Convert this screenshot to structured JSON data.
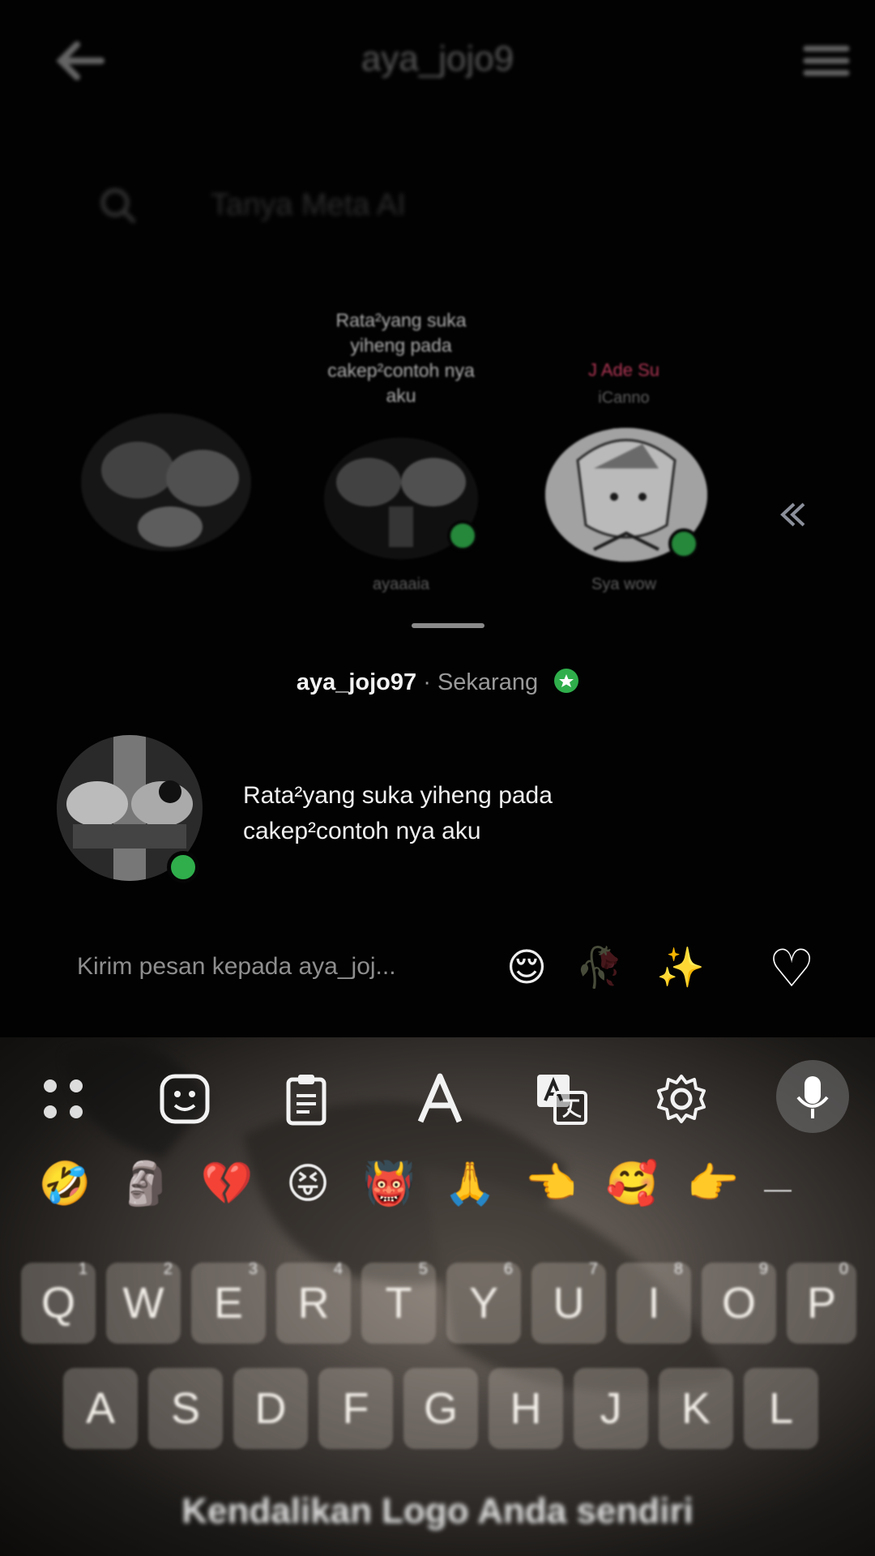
{
  "header": {
    "title": "aya_jojo9"
  },
  "search": {
    "placeholder": "Tanya Meta AI"
  },
  "notes": [
    {
      "bubble": "Rata²yang suka yiheng pada cakep²contoh nya aku",
      "name": "ayaaaia"
    },
    {
      "music": "J Ade Su",
      "music_artist": "iCanno",
      "name": "Sya wow"
    }
  ],
  "sheet": {
    "username": "aya_jojo97",
    "separator": "·",
    "time": "Sekarang",
    "message": "Rata²yang suka yiheng pada cakep²contoh nya aku"
  },
  "composer": {
    "placeholder": "Kirim pesan kepada aya_joj...",
    "quick_reactions": [
      "😌",
      "🥀",
      "✨",
      "♡"
    ]
  },
  "keyboard": {
    "emoji_suggestions": [
      "🤣",
      "🗿",
      "💔",
      "😝",
      "👹",
      "🙏",
      "👈",
      "🥰",
      "👉",
      "—"
    ],
    "row1": [
      {
        "k": "Q",
        "n": "1"
      },
      {
        "k": "W",
        "n": "2"
      },
      {
        "k": "E",
        "n": "3"
      },
      {
        "k": "R",
        "n": "4"
      },
      {
        "k": "T",
        "n": "5"
      },
      {
        "k": "Y",
        "n": "6"
      },
      {
        "k": "U",
        "n": "7"
      },
      {
        "k": "I",
        "n": "8"
      },
      {
        "k": "O",
        "n": "9"
      },
      {
        "k": "P",
        "n": "0"
      }
    ],
    "row2": [
      "A",
      "S",
      "D",
      "F",
      "G",
      "H",
      "J",
      "K",
      "L"
    ],
    "suggestion_text": "Kendalikan Logo Anda sendiri"
  },
  "colors": {
    "online": "#2fae4b",
    "music": "#e0456b"
  }
}
